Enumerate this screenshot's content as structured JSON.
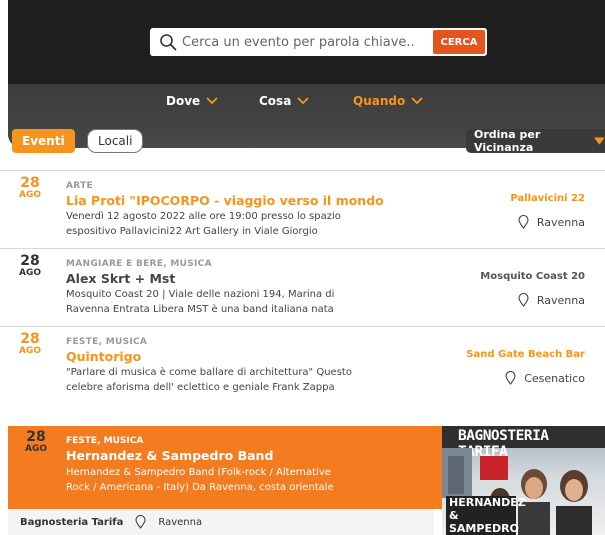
{
  "search": {
    "placeholder": "Cerca un evento per parola chiave..",
    "button_label": "CERCA"
  },
  "filters": [
    {
      "label": "Dove",
      "active": false
    },
    {
      "label": "Cosa",
      "active": false
    },
    {
      "label": "Quando",
      "active": true
    }
  ],
  "tabs": {
    "eventi": "Eventi",
    "locali": "Locali"
  },
  "sort": {
    "label": "Ordina per Vicinanza"
  },
  "events": [
    {
      "day": "28",
      "month": "AGO",
      "category": "ARTE",
      "title": "Lia Proti \"IPOCORPO - viaggio verso il mondo",
      "description_line1": "Venerdì 12 agosto 2022 alle ore 19:00 presso lo spazio",
      "description_line2": "espositivo Pallavicini22 Art Gallery in Viale Giorgio",
      "venue": "Pallavicini 22",
      "city": "Ravenna",
      "highlight": true
    },
    {
      "day": "28",
      "month": "AGO",
      "category": "MANGIARE E BERE, MUSICA",
      "title": "Alex Skrt + Mst",
      "description_line1": "Mosquito Coast 20 | Viale delle nazioni 194, Marina di",
      "description_line2": "Ravenna  Entrata Libera MST è una band italiana nata",
      "venue": "Mosquito Coast 20",
      "city": "Ravenna",
      "highlight": false
    },
    {
      "day": "28",
      "month": "AGO",
      "category": "FESTE, MUSICA",
      "title": "Quintorigo",
      "description_line1": "\"Parlare di musica è come ballare di architettura\" Questo",
      "description_line2": "celebre aforisma dell' eclettico e geniale Frank Zappa",
      "venue": "Sand Gate Beach Bar",
      "city": "Cesenatico",
      "highlight": true
    }
  ],
  "featured": {
    "day": "28",
    "month": "AGO",
    "category": "FESTE, MUSICA",
    "title": "Hernandez & Sampedro Band",
    "description_line1": "Hernandez & Sampedro Band (Folk-rock / Alternative",
    "description_line2": "Rock / Americana - Italy) Da Ravenna, costa orientale",
    "venue": "Bagnosteria Tarifa",
    "city": "Ravenna",
    "image_banner": "BAGNOSTERIA TARIFA",
    "image_sign_line1": "HERNANDEZ &",
    "image_sign_line2": "SAMPEDRO"
  },
  "colors": {
    "accent": "#f7941d",
    "search_button": "#e5531f",
    "featured_bg": "#f47c20",
    "header_bg": "#1f1f1f"
  }
}
